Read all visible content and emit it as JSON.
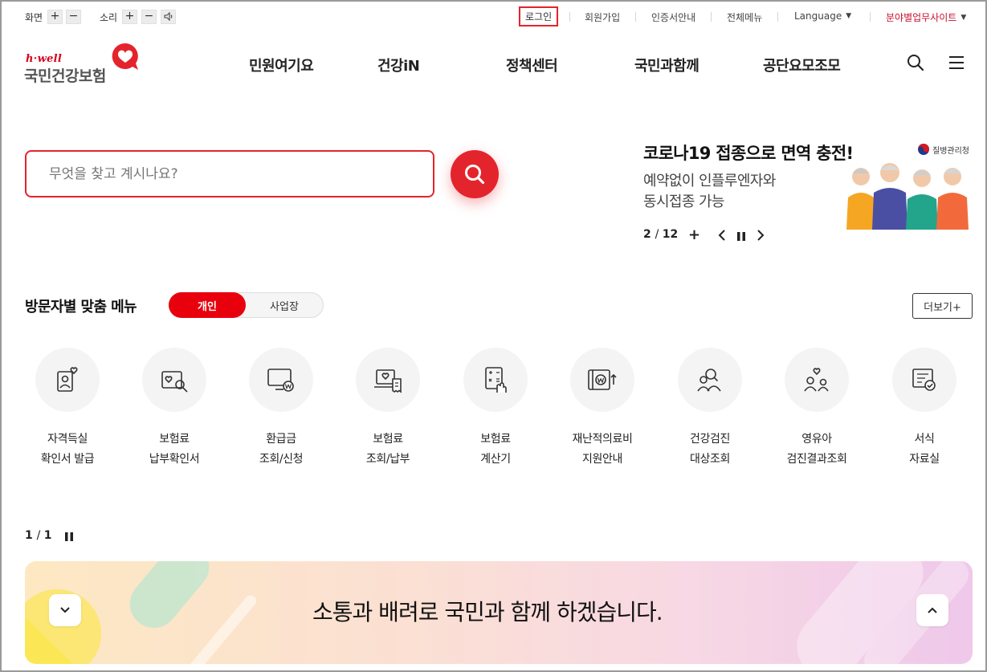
{
  "utility": {
    "screen_label": "화면",
    "sound_label": "소리",
    "plus": "+",
    "minus": "−",
    "links": {
      "login": "로그인",
      "signup": "회원가입",
      "cert": "인증서안내",
      "allmenu": "전체메뉴",
      "language": "Language",
      "field_sites": "분야별업무사이트"
    }
  },
  "logo": {
    "en": "h·well",
    "ko": "국민건강보험"
  },
  "nav": [
    "민원여기요",
    "건강iN",
    "정책센터",
    "국민과함께",
    "공단요모조모"
  ],
  "search": {
    "placeholder": "무엇을 찾고 계시나요?"
  },
  "banner": {
    "title": "코로나19 접종으로 면역 충전!",
    "line1": "예약없이 인플루엔자와",
    "line2": "동시접종 가능",
    "agency": "질병관리청",
    "current": "2",
    "total": "12",
    "plus": "+"
  },
  "visitor": {
    "title": "방문자별 맞춤 메뉴",
    "tab_on": "개인",
    "tab_off": "사업장",
    "more": "더보기+",
    "items": [
      {
        "line1": "자격득실",
        "line2": "확인서 발급",
        "icon": "profile-heart-icon"
      },
      {
        "line1": "보험료",
        "line2": "납부확인서",
        "icon": "card-search-icon"
      },
      {
        "line1": "환급금",
        "line2": "조회/신청",
        "icon": "monitor-won-icon"
      },
      {
        "line1": "보험료",
        "line2": "조회/납부",
        "icon": "laptop-receipt-icon"
      },
      {
        "line1": "보험료",
        "line2": "계산기",
        "icon": "calculator-hand-icon"
      },
      {
        "line1": "재난적의료비",
        "line2": "지원안내",
        "icon": "wallet-won-icon"
      },
      {
        "line1": "건강검진",
        "line2": "대상조회",
        "icon": "people-search-icon"
      },
      {
        "line1": "영유아",
        "line2": "검진결과조회",
        "icon": "family-heart-icon"
      },
      {
        "line1": "서식",
        "line2": "자료실",
        "icon": "document-check-icon"
      }
    ],
    "page_current": "1",
    "page_total": "1"
  },
  "bottom": {
    "text": "소통과 배려로 국민과 함께 하겠습니다."
  },
  "colors": {
    "accent": "#e4242c",
    "toggle_on": "#e8000d",
    "field_link": "#c8102e"
  }
}
